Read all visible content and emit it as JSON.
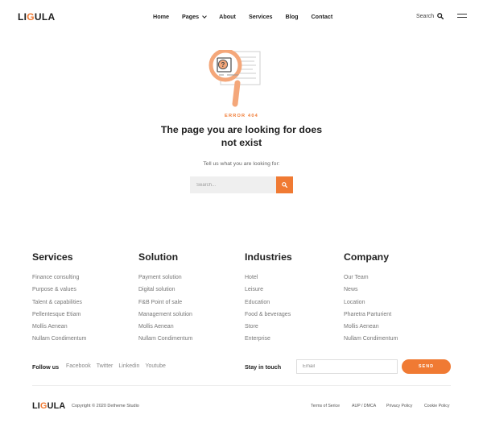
{
  "header": {
    "logo_prefix": "LI",
    "logo_accent": "G",
    "logo_suffix": "ULA",
    "nav": [
      "Home",
      "Pages",
      "About",
      "Services",
      "Blog",
      "Contact"
    ],
    "search_label": "Search"
  },
  "error": {
    "code": "ERROR 404",
    "title": "The page you are looking for does not exist",
    "subtitle": "Tell us what you are looking for:",
    "search_placeholder": "Search..."
  },
  "footer": {
    "columns": [
      {
        "title": "Services",
        "items": [
          "Finance consulting",
          "Purpose & values",
          "Talent & capabilities",
          "Pellentesque Etiam",
          "Mollis Aenean",
          "Nullam Condimentum"
        ]
      },
      {
        "title": "Solution",
        "items": [
          "Payment solution",
          "Digital solution",
          "F&B Point of sale",
          "Management solution",
          "Mollis Aenean",
          "Nullam Condimentum"
        ]
      },
      {
        "title": "Industries",
        "items": [
          "Hotel",
          "Leisure",
          "Education",
          "Food & beverages",
          "Store",
          "Enterprise"
        ]
      },
      {
        "title": "Company",
        "items": [
          "Our Team",
          "News",
          "Location",
          "Pharetra Parturient",
          "Mollis Aenean",
          "Nullam Condimentum"
        ]
      }
    ],
    "follow_label": "Follow us",
    "social": [
      "Facebook",
      "Twitter",
      "Linkedin",
      "Youtube"
    ],
    "stay_label": "Stay in touch",
    "email_placeholder": "Email",
    "send_label": "SEND",
    "copyright": "Copyright © 2020 Detheme Studio",
    "legal": [
      "Terms of Serice",
      "AUP / DMCA",
      "Privacy Policy",
      "Cookie Policy"
    ]
  },
  "colors": {
    "accent": "#f07a33",
    "text": "#222222",
    "muted": "#777777"
  },
  "icons": [
    "search-icon",
    "hamburger-icon",
    "magnifier-document-illustration"
  ]
}
